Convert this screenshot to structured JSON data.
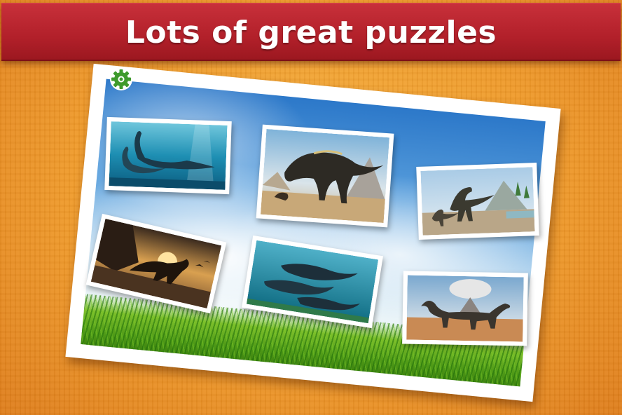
{
  "banner": {
    "title": "Lots of great puzzles"
  },
  "board": {
    "settings_icon": "gear-icon"
  },
  "puzzles": [
    {
      "name": "underwater-plesiosaurs"
    },
    {
      "name": "allosaurus-canyon"
    },
    {
      "name": "raptors-lakeside"
    },
    {
      "name": "dinosaur-sunset"
    },
    {
      "name": "ichthyosaurs-sea"
    },
    {
      "name": "sauropods-volcano"
    }
  ],
  "colors": {
    "banner": "#b2202a",
    "background": "#ef9a2a",
    "gear": "#3e9a2c"
  }
}
